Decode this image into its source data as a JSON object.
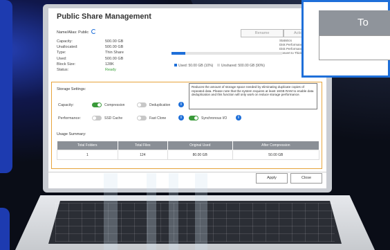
{
  "window": {
    "title": "Public Share Management"
  },
  "share": {
    "name_label": "Name/Alias: Public"
  },
  "properties": [
    {
      "key": "Capacity:",
      "value": "500.00 GB"
    },
    {
      "key": "Unallocated:",
      "value": "500.00 GB"
    },
    {
      "key": "Type:",
      "value": "Thin Share"
    },
    {
      "key": "Used:",
      "value": "500.00 GB"
    },
    {
      "key": "Block Size:",
      "value": "128K"
    },
    {
      "key": "Status:",
      "value": "Ready"
    }
  ],
  "buttons": {
    "rename": "Rename",
    "actions": "Actions",
    "apply": "Apply",
    "close": "Close"
  },
  "stats": [
    "Statistics",
    "Disk Performance",
    "Disk Performance",
    "Convert to Thick"
  ],
  "usage": {
    "used_label": "Used: 50.00 GB (10%)",
    "unshared_label": "Unshared: 500.00 GB (90%)",
    "used_fraction": 0.125,
    "used_color": "#1e6fd9",
    "unshared_color": "#e4e4e4"
  },
  "storage_settings": {
    "title": "Storage Settings:",
    "note": "Reduces the amount of storage space needed by eliminating duplicate copies of repeated data. Please note that the system requires at least 16GB RAM to enable data deduplication and this function will only work on reduce storage performance.",
    "capacity_label": "Capacity:",
    "performance_label": "Performance:",
    "toggles": [
      {
        "label": "Compression",
        "on": true
      },
      {
        "label": "Deduplication",
        "on": false
      },
      {
        "label": "SSD Cache",
        "on": false
      },
      {
        "label": "Fast Clone",
        "on": false
      },
      {
        "label": "Synchronous I/O",
        "on": true
      }
    ]
  },
  "usage_summary": {
    "title": "Usage Summary:",
    "columns": [
      "Total Folders",
      "Total Files",
      "Original Used",
      "After Compression"
    ],
    "rows": [
      [
        "1",
        "124",
        "80.00 GB",
        "50.00 GB"
      ]
    ]
  },
  "popup": {
    "header": "To"
  }
}
